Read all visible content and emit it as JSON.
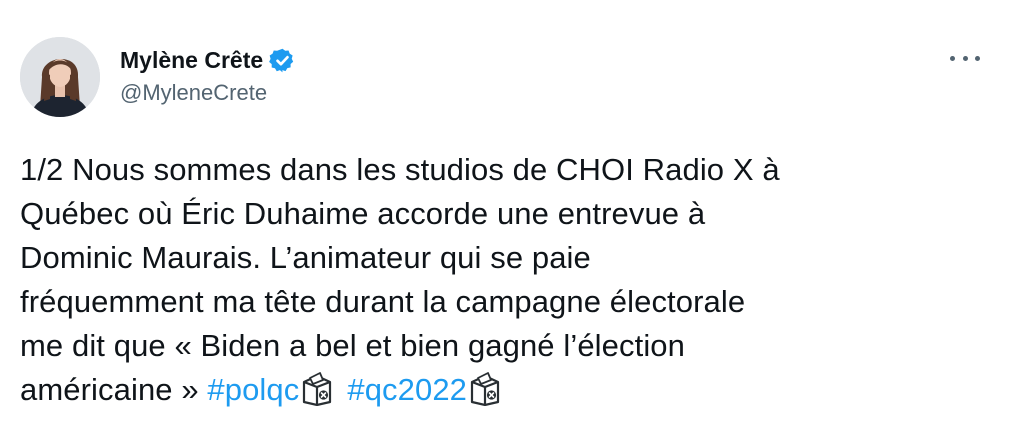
{
  "author": {
    "display_name": "Mylène Crête",
    "handle": "@MyleneCrete",
    "verified": true
  },
  "tweet": {
    "lines": [
      "1/2 Nous sommes dans les studios de CHOI Radio X à",
      "Québec où Éric Duhaime accorde une entrevue à",
      "Dominic Maurais. L’animateur qui se paie",
      "fréquemment ma tête durant la campagne électorale",
      "me dit que « Biden a bel et bien gagné l’élection"
    ],
    "last_line_text": "américaine » ",
    "hashtags": [
      "#polqc",
      "#qc2022"
    ]
  },
  "icons": {
    "verified": "verified-badge-icon",
    "more": "more-options-icon",
    "emoji": "ballot-box-emoji-icon"
  },
  "colors": {
    "text": "#0f1419",
    "secondary": "#536471",
    "link": "#1d9bf0",
    "verified": "#1d9bf0"
  }
}
